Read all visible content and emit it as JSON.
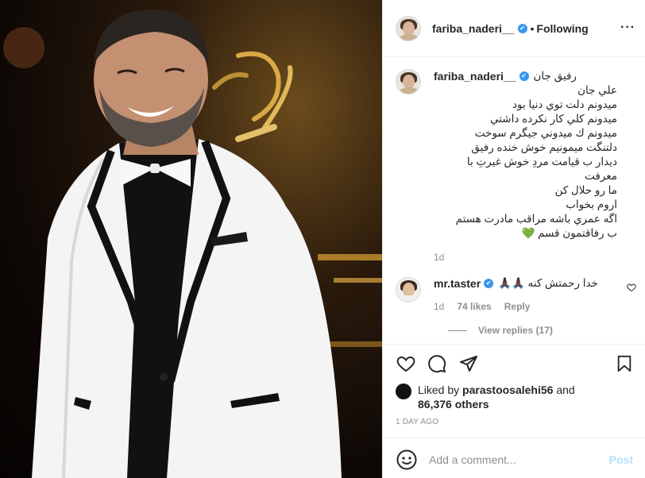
{
  "header": {
    "username": "fariba_naderi__",
    "verified": true,
    "separator": "•",
    "follow_status": "Following",
    "more_icon": "more-horizontal-icon"
  },
  "caption": {
    "username": "fariba_naderi__",
    "first_line": "رفيق جان",
    "lines": [
      "علي جان",
      "ميدونم دلت توي دنيا بود",
      "ميدونم كلي كار نكرده داشتي",
      "ميدونم ك ميدوني جيگرم سوخت",
      "دلتنگت ميمونيم خوش خنده رفيق",
      "ديدار ب قيامت مردِ خوش غيرتِ با معرفت",
      "ما رو حلال كن",
      "اروم بخواب",
      "اگه عمري باشه مراقب مادرت هستم",
      "ب رفاقتمون قسم 💚"
    ],
    "time": "1d"
  },
  "comment": {
    "username": "mr.taster",
    "verified": true,
    "text": "خدا رحمتش كنه 🙏🏿🙏🏿",
    "time": "1d",
    "likes": "74 likes",
    "reply": "Reply",
    "view_replies": "View replies (17)"
  },
  "actions": {
    "like_icon": "heart-icon",
    "comment_icon": "comment-icon",
    "share_icon": "share-icon",
    "save_icon": "bookmark-icon"
  },
  "likes": {
    "prefix": "Liked by",
    "user": "parastoosalehi56",
    "and": "and",
    "others": "86,376 others"
  },
  "posted_ago": "1 DAY AGO",
  "add_comment": {
    "placeholder": "Add a comment...",
    "post_label": "Post",
    "emoji_icon": "smiley-icon"
  },
  "colors": {
    "accent_blue": "#3897f0",
    "post_disabled": "#b2dffc",
    "muted": "#8e8e8e",
    "heart_green": "#2bb42b"
  }
}
